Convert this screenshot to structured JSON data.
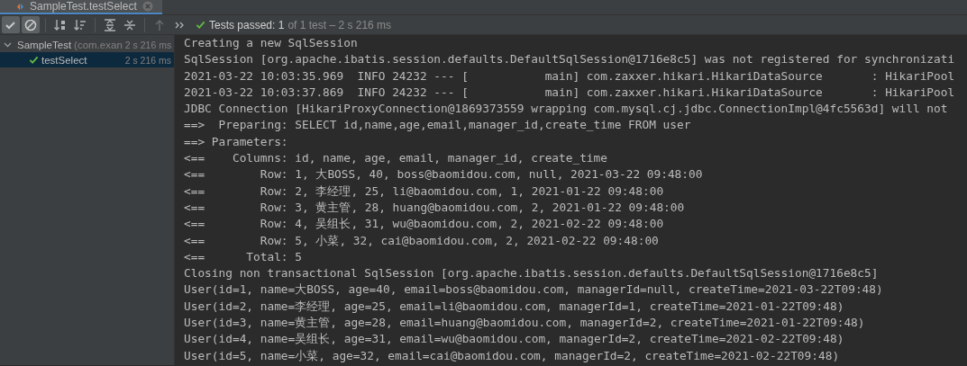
{
  "tabs": [
    {
      "label": "SampleTest.testSelect",
      "selected": true
    }
  ],
  "toolbar": [
    {
      "kind": "show-passed",
      "on": true,
      "disabled": false
    },
    {
      "kind": "show-ignored",
      "on": true,
      "disabled": false
    },
    {
      "kind": "sort-alpha",
      "on": false,
      "disabled": false
    },
    {
      "kind": "sort-duration",
      "on": false,
      "disabled": false
    },
    {
      "kind": "expand-all",
      "on": false,
      "disabled": false
    },
    {
      "kind": "collapse-all",
      "on": false,
      "disabled": false
    },
    {
      "kind": "prev-failed",
      "on": false,
      "disabled": true
    },
    {
      "kind": "more",
      "on": false,
      "disabled": false
    }
  ],
  "status": {
    "passed": "Tests passed: 1",
    "detail": "of 1 test – 2 s 216 ms"
  },
  "tree": [
    {
      "label": "SampleTest",
      "detail": "(com.exan",
      "time": "2 s 216 ms",
      "expanded": true,
      "selected": false,
      "children": [
        {
          "label": "testSelect",
          "time": "2 s 216 ms",
          "selected": true
        }
      ]
    }
  ],
  "console": [
    "Creating a new SqlSession",
    "SqlSession [org.apache.ibatis.session.defaults.DefaultSqlSession@1716e8c5] was not registered for synchronizati",
    "2021-03-22 10:03:35.969  INFO 24232 --- [           main] com.zaxxer.hikari.HikariDataSource       : HikariPool",
    "2021-03-22 10:03:37.869  INFO 24232 --- [           main] com.zaxxer.hikari.HikariDataSource       : HikariPool",
    "JDBC Connection [HikariProxyConnection@1869373559 wrapping com.mysql.cj.jdbc.ConnectionImpl@4fc5563d] will not",
    "==>  Preparing: SELECT id,name,age,email,manager_id,create_time FROM user",
    "==> Parameters: ",
    "<==    Columns: id, name, age, email, manager_id, create_time",
    "<==        Row: 1, 大BOSS, 40, boss@baomidou.com, null, 2021-03-22 09:48:00",
    "<==        Row: 2, 李经理, 25, li@baomidou.com, 1, 2021-01-22 09:48:00",
    "<==        Row: 3, 黄主管, 28, huang@baomidou.com, 2, 2021-01-22 09:48:00",
    "<==        Row: 4, 吴组长, 31, wu@baomidou.com, 2, 2021-02-22 09:48:00",
    "<==        Row: 5, 小菜, 32, cai@baomidou.com, 2, 2021-02-22 09:48:00",
    "<==      Total: 5",
    "Closing non transactional SqlSession [org.apache.ibatis.session.defaults.DefaultSqlSession@1716e8c5]",
    "User(id=1, name=大BOSS, age=40, email=boss@baomidou.com, managerId=null, createTime=2021-03-22T09:48)",
    "User(id=2, name=李经理, age=25, email=li@baomidou.com, managerId=1, createTime=2021-01-22T09:48)",
    "User(id=3, name=黄主管, age=28, email=huang@baomidou.com, managerId=2, createTime=2021-01-22T09:48)",
    "User(id=4, name=吴组长, age=31, email=wu@baomidou.com, managerId=2, createTime=2021-02-22T09:48)",
    "User(id=5, name=小菜, age=32, email=cai@baomidou.com, managerId=2, createTime=2021-02-22T09:48)"
  ]
}
